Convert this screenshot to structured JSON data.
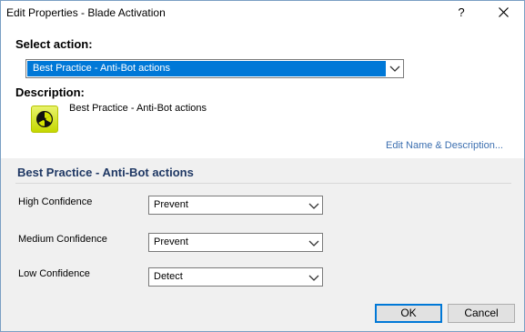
{
  "window": {
    "title": "Edit Properties - Blade Activation",
    "help_glyph": "?",
    "close_icon": "close-icon"
  },
  "select_action": {
    "label": "Select action:",
    "selected": "Best Practice - Anti-Bot actions",
    "highlight_color": "#0078d7"
  },
  "description": {
    "label": "Description:",
    "icon": "radiation-icon",
    "icon_color": "#d4e400",
    "text": "Best Practice - Anti-Bot actions",
    "edit_link": "Edit Name & Description..."
  },
  "section": {
    "title": "Best Practice - Anti-Bot actions",
    "title_color": "#1f3864",
    "rows": [
      {
        "label": "High Confidence",
        "value": "Prevent"
      },
      {
        "label": "Medium Confidence",
        "value": "Prevent"
      },
      {
        "label": "Low Confidence",
        "value": "Detect"
      }
    ]
  },
  "buttons": {
    "ok": "OK",
    "cancel": "Cancel"
  }
}
